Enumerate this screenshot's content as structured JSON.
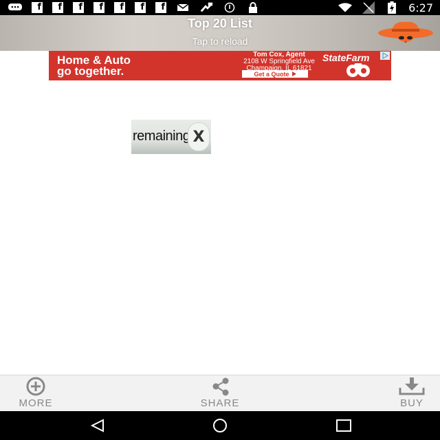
{
  "status_bar": {
    "time": "6:27",
    "left_icons": [
      "message-icon",
      "facebook-icon",
      "facebook-icon",
      "facebook-icon",
      "facebook-icon",
      "facebook-icon",
      "facebook-icon",
      "facebook-icon",
      "email-icon",
      "sync-icon",
      "alarm-icon",
      "lock-icon"
    ],
    "fb_letter": "f",
    "right_icons": [
      "wifi-icon",
      "signal-icon",
      "battery-charging-icon"
    ]
  },
  "header": {
    "title": "Top 20 List",
    "subtitle": "Tap to reload",
    "logo_icon": "spy-hat-logo-icon"
  },
  "ad": {
    "headline_line1": "Home & Auto",
    "headline_line2": "go together.",
    "agent_name": "Tom Cox, Agent",
    "agent_address1": "2108 W Springfield Ave",
    "agent_address2": "Champaign, IL 61821",
    "cta": "Get a Quote",
    "brand": "StateFarm",
    "colors": {
      "background": "#d2342c",
      "text": "#ffffff"
    }
  },
  "countdown": {
    "label": "remaining",
    "close_symbol": "X"
  },
  "toolbar": {
    "more_label": "MORE",
    "share_label": "SHARE",
    "buy_label": "BUY"
  },
  "nav": {
    "icons": [
      "back-icon",
      "home-icon",
      "recents-icon"
    ]
  }
}
